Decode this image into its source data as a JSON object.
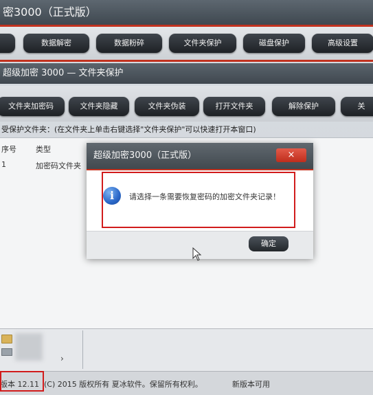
{
  "window": {
    "title": "超级加密3000（正式版）",
    "title_visible": "密3000（正式版）"
  },
  "toolbar": {
    "buttons": [
      {
        "label": "",
        "icon": "partial-button"
      },
      {
        "label": "数据解密"
      },
      {
        "label": "数据粉碎"
      },
      {
        "label": "文件夹保护"
      },
      {
        "label": "磁盘保护"
      },
      {
        "label": "高级设置"
      }
    ]
  },
  "subheader": {
    "title": "超级加密 3000 — 文件夹保护"
  },
  "toolbar2": {
    "buttons": [
      {
        "label": "文件夹加密码"
      },
      {
        "label": "文件夹隐藏"
      },
      {
        "label": "文件夹伪装"
      },
      {
        "label": "打开文件夹"
      },
      {
        "label": "解除保护"
      },
      {
        "label": "关"
      }
    ]
  },
  "hint": "受保护文件夹：(在文件夹上单击右键选择\"文件夹保护\"可以快速打开本窗口)",
  "list": {
    "columns": [
      "序号",
      "类型"
    ],
    "rows": [
      {
        "index": "1",
        "type": "加密码文件夹"
      }
    ]
  },
  "status": {
    "version": "版本 12.11",
    "copyright": "(C) 2015 版权所有 夏冰软件。保留所有权利。",
    "new_version": "新版本可用"
  },
  "dialog": {
    "title": "超级加密3000（正式版）",
    "close": "×",
    "message": "请选择一条需要恢复密码的加密文件夹记录！",
    "ok": "确定"
  },
  "colors": {
    "accent_red": "#c2321f",
    "highlight_red": "#d11b1b",
    "info_blue": "#2a67c8"
  }
}
